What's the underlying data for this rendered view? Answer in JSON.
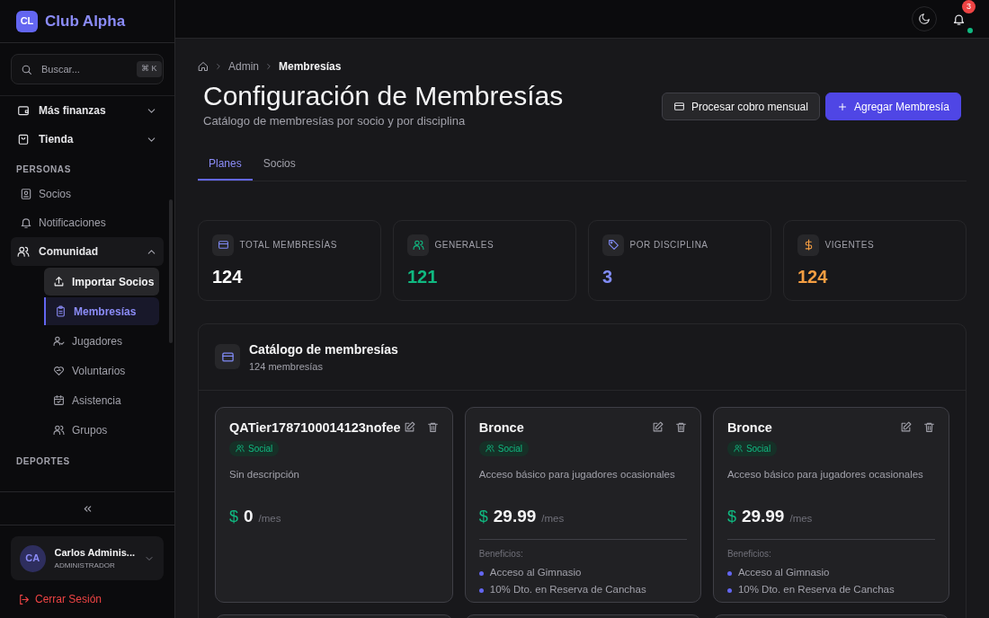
{
  "brand": {
    "logo": "CL",
    "name": "Club Alpha"
  },
  "search": {
    "placeholder": "Buscar...",
    "shortcut": "⌘ K"
  },
  "sidebar": {
    "items": [
      {
        "kind": "group",
        "label": "Más finanzas",
        "expanded": false,
        "selected": false
      },
      {
        "kind": "group",
        "label": "Tienda",
        "expanded": false,
        "selected": false
      },
      {
        "kind": "section",
        "label": "PERSONAS"
      },
      {
        "kind": "link",
        "label": "Socios"
      },
      {
        "kind": "link",
        "label": "Notificaciones"
      },
      {
        "kind": "group",
        "label": "Comunidad",
        "expanded": true,
        "selected": true,
        "children": [
          {
            "label": "Importar Socios",
            "hovered": true,
            "selected": false
          },
          {
            "label": "Membresías",
            "hovered": false,
            "selected": true
          },
          {
            "label": "Jugadores",
            "hovered": false,
            "selected": false
          },
          {
            "label": "Voluntarios",
            "hovered": false,
            "selected": false
          },
          {
            "label": "Asistencia",
            "hovered": false,
            "selected": false
          },
          {
            "label": "Grupos",
            "hovered": false,
            "selected": false
          }
        ]
      },
      {
        "kind": "section",
        "label": "DEPORTES"
      }
    ]
  },
  "user": {
    "initials": "CA",
    "name": "Carlos Adminis...",
    "role": "ADMINISTRADOR"
  },
  "logout": "Cerrar Sesión",
  "notifications": {
    "count": "3",
    "online": true
  },
  "breadcrumb": [
    "Admin",
    "Membresías"
  ],
  "page": {
    "title": "Configuración de Membresías",
    "subtitle": "Catálogo de membresías por socio y por disciplina"
  },
  "actions": [
    {
      "kind": "secondary",
      "label": "Procesar cobro mensual"
    },
    {
      "kind": "primary",
      "label": "Agregar Membresía"
    }
  ],
  "tabs": [
    {
      "label": "Planes",
      "selected": true
    },
    {
      "label": "Socios",
      "selected": false
    }
  ],
  "stats": [
    {
      "label": "TOTAL MEMBRESÍAS",
      "value": "124",
      "color": "#ffffff"
    },
    {
      "label": "GENERALES",
      "value": "121",
      "color": "#10b981"
    },
    {
      "label": "POR DISCIPLINA",
      "value": "3",
      "color": "#818cf8"
    },
    {
      "label": "VIGENTES",
      "value": "124",
      "color": "#f59e42"
    }
  ],
  "catalog": {
    "title": "Catálogo de membresías",
    "count": "124 membresías",
    "plans": [
      {
        "name": "QATier1787100014123nofee",
        "tag": "Social",
        "description": "Sin descripción",
        "currency": "$",
        "price": "0",
        "period": "/mes"
      },
      {
        "name": "Bronce",
        "tag": "Social",
        "description": "Acceso básico para jugadores ocasionales",
        "currency": "$",
        "price": "29.99",
        "period": "/mes",
        "benefits_title": "Beneficios:",
        "benefits": [
          "Acceso al Gimnasio",
          "10% Dto. en Reserva de Canchas"
        ]
      },
      {
        "name": "Bronce",
        "tag": "Social",
        "description": "Acceso básico para jugadores ocasionales",
        "currency": "$",
        "price": "29.99",
        "period": "/mes",
        "benefits_title": "Beneficios:",
        "benefits": [
          "Acceso al Gimnasio",
          "10% Dto. en Reserva de Canchas"
        ]
      }
    ]
  }
}
